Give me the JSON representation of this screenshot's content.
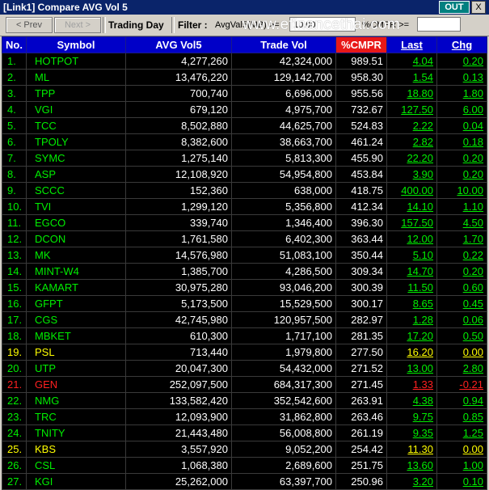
{
  "window": {
    "title": "[Link1] Compare AVG Vol 5",
    "out_label": "OUT",
    "close_label": "X"
  },
  "toolbar": {
    "prev_label": "< Prev",
    "next_label": "Next >",
    "mode_label": "Trading Day",
    "filter_label": "Filter :",
    "filter_field": "AvgVal5(MB) >=",
    "filter_value": "10.00",
    "cmpr_field": "%CMPR >=",
    "cmpr_value": ""
  },
  "watermark": "www.efinancethai.com",
  "columns": [
    "No.",
    "Symbol",
    "AVG Vol5",
    "Trade Vol",
    "%CMPR",
    "Last",
    "Chg"
  ],
  "colors": {
    "up": "#00ee00",
    "flat": "#ffff00",
    "down": "#ff2020"
  },
  "rows": [
    {
      "no": "1.",
      "symbol": "HOTPOT",
      "avg": "4,277,260",
      "vol": "42,324,000",
      "cmpr": "989.51",
      "last": "4.04",
      "chg": "0.20",
      "color": "up"
    },
    {
      "no": "2.",
      "symbol": "ML",
      "avg": "13,476,220",
      "vol": "129,142,700",
      "cmpr": "958.30",
      "last": "1.54",
      "chg": "0.13",
      "color": "up"
    },
    {
      "no": "3.",
      "symbol": "TPP",
      "avg": "700,740",
      "vol": "6,696,000",
      "cmpr": "955.56",
      "last": "18.80",
      "chg": "1.80",
      "color": "up"
    },
    {
      "no": "4.",
      "symbol": "VGI",
      "avg": "679,120",
      "vol": "4,975,700",
      "cmpr": "732.67",
      "last": "127.50",
      "chg": "6.00",
      "color": "up"
    },
    {
      "no": "5.",
      "symbol": "TCC",
      "avg": "8,502,880",
      "vol": "44,625,700",
      "cmpr": "524.83",
      "last": "2.22",
      "chg": "0.04",
      "color": "up"
    },
    {
      "no": "6.",
      "symbol": "TPOLY",
      "avg": "8,382,600",
      "vol": "38,663,700",
      "cmpr": "461.24",
      "last": "2.82",
      "chg": "0.18",
      "color": "up"
    },
    {
      "no": "7.",
      "symbol": "SYMC",
      "avg": "1,275,140",
      "vol": "5,813,300",
      "cmpr": "455.90",
      "last": "22.20",
      "chg": "0.20",
      "color": "up"
    },
    {
      "no": "8.",
      "symbol": "ASP",
      "avg": "12,108,920",
      "vol": "54,954,800",
      "cmpr": "453.84",
      "last": "3.90",
      "chg": "0.20",
      "color": "up"
    },
    {
      "no": "9.",
      "symbol": "SCCC",
      "avg": "152,360",
      "vol": "638,000",
      "cmpr": "418.75",
      "last": "400.00",
      "chg": "10.00",
      "color": "up"
    },
    {
      "no": "10.",
      "symbol": "TVI",
      "avg": "1,299,120",
      "vol": "5,356,800",
      "cmpr": "412.34",
      "last": "14.10",
      "chg": "1.10",
      "color": "up"
    },
    {
      "no": "11.",
      "symbol": "EGCO",
      "avg": "339,740",
      "vol": "1,346,400",
      "cmpr": "396.30",
      "last": "157.50",
      "chg": "4.50",
      "color": "up"
    },
    {
      "no": "12.",
      "symbol": "DCON",
      "avg": "1,761,580",
      "vol": "6,402,300",
      "cmpr": "363.44",
      "last": "12.00",
      "chg": "1.70",
      "color": "up"
    },
    {
      "no": "13.",
      "symbol": "MK",
      "avg": "14,576,980",
      "vol": "51,083,100",
      "cmpr": "350.44",
      "last": "5.10",
      "chg": "0.22",
      "color": "up"
    },
    {
      "no": "14.",
      "symbol": "MINT-W4",
      "avg": "1,385,700",
      "vol": "4,286,500",
      "cmpr": "309.34",
      "last": "14.70",
      "chg": "0.20",
      "color": "up"
    },
    {
      "no": "15.",
      "symbol": "KAMART",
      "avg": "30,975,280",
      "vol": "93,046,200",
      "cmpr": "300.39",
      "last": "11.50",
      "chg": "0.60",
      "color": "up"
    },
    {
      "no": "16.",
      "symbol": "GFPT",
      "avg": "5,173,500",
      "vol": "15,529,500",
      "cmpr": "300.17",
      "last": "8.65",
      "chg": "0.45",
      "color": "up"
    },
    {
      "no": "17.",
      "symbol": "CGS",
      "avg": "42,745,980",
      "vol": "120,957,500",
      "cmpr": "282.97",
      "last": "1.28",
      "chg": "0.06",
      "color": "up"
    },
    {
      "no": "18.",
      "symbol": "MBKET",
      "avg": "610,300",
      "vol": "1,717,100",
      "cmpr": "281.35",
      "last": "17.20",
      "chg": "0.50",
      "color": "up"
    },
    {
      "no": "19.",
      "symbol": "PSL",
      "avg": "713,440",
      "vol": "1,979,800",
      "cmpr": "277.50",
      "last": "16.20",
      "chg": "0.00",
      "color": "flat"
    },
    {
      "no": "20.",
      "symbol": "UTP",
      "avg": "20,047,300",
      "vol": "54,432,000",
      "cmpr": "271.52",
      "last": "13.00",
      "chg": "2.80",
      "color": "up"
    },
    {
      "no": "21.",
      "symbol": "GEN",
      "avg": "252,097,500",
      "vol": "684,317,300",
      "cmpr": "271.45",
      "last": "1.33",
      "chg": "-0.21",
      "color": "down"
    },
    {
      "no": "22.",
      "symbol": "NMG",
      "avg": "133,582,420",
      "vol": "352,542,600",
      "cmpr": "263.91",
      "last": "4.38",
      "chg": "0.94",
      "color": "up"
    },
    {
      "no": "23.",
      "symbol": "TRC",
      "avg": "12,093,900",
      "vol": "31,862,800",
      "cmpr": "263.46",
      "last": "9.75",
      "chg": "0.85",
      "color": "up"
    },
    {
      "no": "24.",
      "symbol": "TNITY",
      "avg": "21,443,480",
      "vol": "56,008,800",
      "cmpr": "261.19",
      "last": "9.35",
      "chg": "1.25",
      "color": "up"
    },
    {
      "no": "25.",
      "symbol": "KBS",
      "avg": "3,557,920",
      "vol": "9,052,200",
      "cmpr": "254.42",
      "last": "11.30",
      "chg": "0.00",
      "color": "flat"
    },
    {
      "no": "26.",
      "symbol": "CSL",
      "avg": "1,068,380",
      "vol": "2,689,600",
      "cmpr": "251.75",
      "last": "13.60",
      "chg": "1.00",
      "color": "up"
    },
    {
      "no": "27.",
      "symbol": "KGI",
      "avg": "25,262,000",
      "vol": "63,397,700",
      "cmpr": "250.96",
      "last": "3.20",
      "chg": "0.10",
      "color": "up"
    }
  ]
}
